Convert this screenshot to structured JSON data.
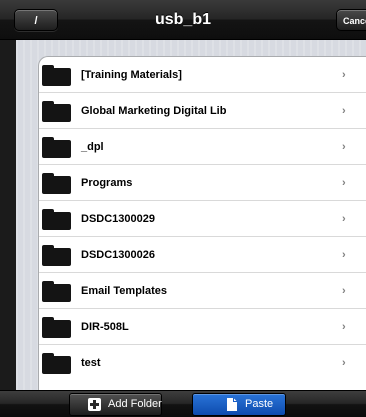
{
  "nav": {
    "title": "usb_b1",
    "back_label": "/",
    "cancel_label": "Cancel"
  },
  "folders": [
    {
      "label": "[Training Materials]"
    },
    {
      "label": "Global Marketing Digital Lib"
    },
    {
      "label": "_dpl"
    },
    {
      "label": "Programs"
    },
    {
      "label": "DSDC1300029"
    },
    {
      "label": "DSDC1300026"
    },
    {
      "label": "Email Templates"
    },
    {
      "label": "DIR-508L"
    },
    {
      "label": "test"
    }
  ],
  "chevron": "›",
  "toolbar": {
    "add_folder_label": "Add Folder",
    "paste_label": "Paste"
  },
  "colors": {
    "paste_button": "#1a5fc8",
    "toolbar": "#1e1e1e",
    "background": "#d7dae1"
  },
  "icons": {
    "row_icon": "folder-icon",
    "row_accessory": "chevron-right-icon",
    "add_folder_icon": "plus-icon",
    "paste_icon": "document-icon"
  }
}
